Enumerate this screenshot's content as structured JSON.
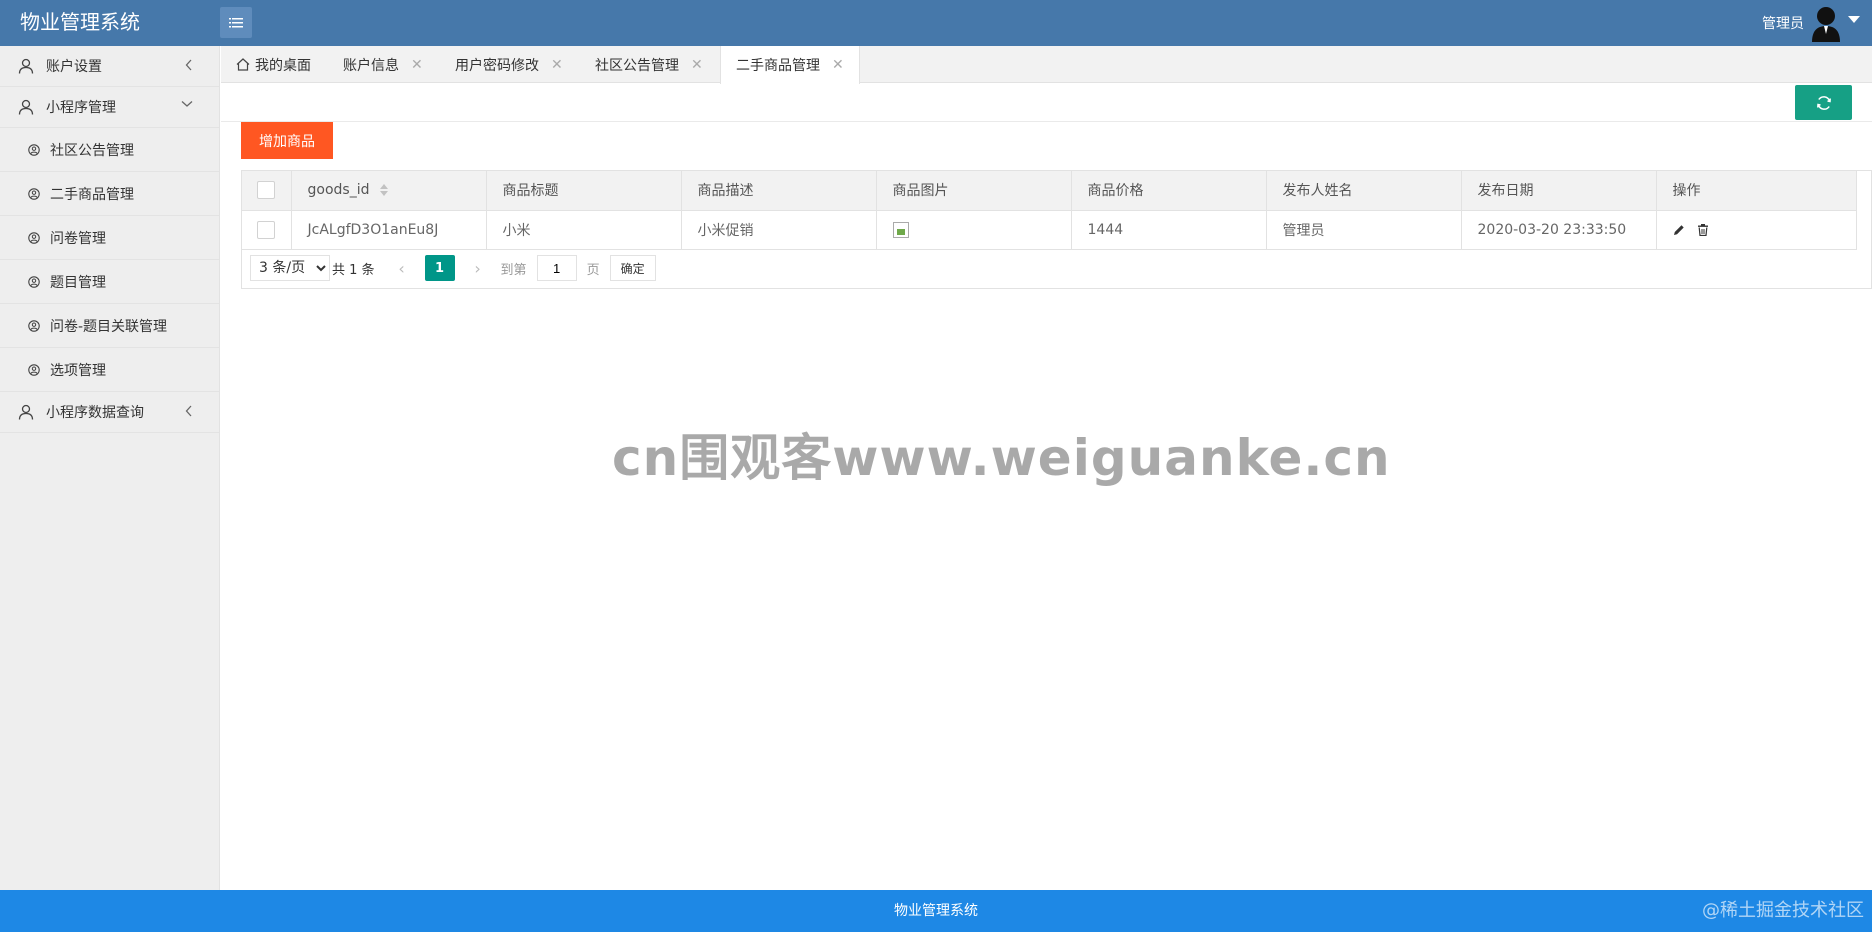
{
  "header": {
    "brand": "物业管理系统",
    "user_name": "管理员",
    "icons": {
      "menu": "menu-lines-icon",
      "avatar": "user-silhouette-icon",
      "caret": "caret-down-icon"
    }
  },
  "sidebar": {
    "items": [
      {
        "label": "账户设置",
        "level": 1,
        "expanded": false,
        "icon": "user-outline-icon"
      },
      {
        "label": "小程序管理",
        "level": 1,
        "expanded": true,
        "icon": "user-outline-icon"
      },
      {
        "label": "社区公告管理",
        "level": 2,
        "icon": "user-circle-icon"
      },
      {
        "label": "二手商品管理",
        "level": 2,
        "icon": "user-circle-icon"
      },
      {
        "label": "问卷管理",
        "level": 2,
        "icon": "user-circle-icon"
      },
      {
        "label": "题目管理",
        "level": 2,
        "icon": "user-circle-icon"
      },
      {
        "label": "问卷-题目关联管理",
        "level": 2,
        "icon": "user-circle-icon"
      },
      {
        "label": "选项管理",
        "level": 2,
        "icon": "user-circle-icon"
      },
      {
        "label": "小程序数据查询",
        "level": 1,
        "expanded": false,
        "icon": "user-outline-icon"
      }
    ]
  },
  "tabs": [
    {
      "label": "我的桌面",
      "closable": false,
      "active": false
    },
    {
      "label": "账户信息",
      "closable": true,
      "active": false
    },
    {
      "label": "用户密码修改",
      "closable": true,
      "active": false
    },
    {
      "label": "社区公告管理",
      "closable": true,
      "active": false
    },
    {
      "label": "二手商品管理",
      "closable": true,
      "active": true
    }
  ],
  "toolbar": {
    "add_label": "增加商品",
    "refresh_icon": "refresh-icon"
  },
  "table": {
    "columns": [
      "goods_id",
      "商品标题",
      "商品描述",
      "商品图片",
      "商品价格",
      "发布人姓名",
      "发布日期",
      "操作"
    ],
    "rows": [
      {
        "goods_id": "JcALgfD3O1anEu8J",
        "title": "小米",
        "desc": "小米促销",
        "image": "broken-image-icon",
        "price": "1444",
        "publisher": "管理员",
        "date": "2020-03-20 23:33:50"
      }
    ]
  },
  "pagination": {
    "page_size": "3 条/页",
    "total": "共 1 条",
    "current": "1",
    "goto_label": "到第",
    "goto_value": "1",
    "page_suffix": "页",
    "confirm": "确定"
  },
  "watermark": "cn围观客www.weiguanke.cn",
  "footer": {
    "text": "物业管理系统",
    "corner": "@稀土掘金技术社区"
  },
  "colors": {
    "header": "#4678aa",
    "footer": "#1e88e5",
    "add_button": "#ff5722",
    "refresh_button": "#16a085",
    "page_current": "#009688"
  }
}
